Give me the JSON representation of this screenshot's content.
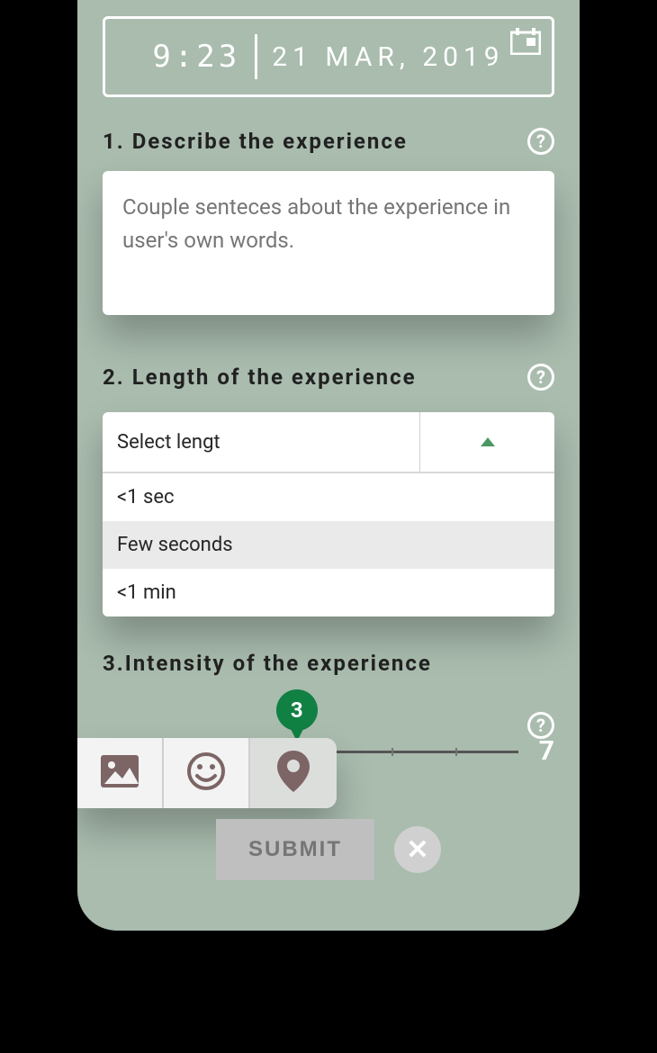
{
  "datetime": {
    "time": "9:23",
    "date": "21 MAR, 2019"
  },
  "sections": {
    "describe": {
      "title": "1. Describe the experience",
      "placeholder": "Couple senteces about the experience in user's own words."
    },
    "length": {
      "title": "2. Length of the experience",
      "select_label": "Select lengt",
      "options": [
        "<1 sec",
        "Few seconds",
        "<1 min"
      ],
      "selected_index": 1
    },
    "intensity": {
      "title": "3.Intensity of the experience",
      "min": "1",
      "max": "7",
      "value": "3",
      "value_fraction": 0.4166
    }
  },
  "submit": {
    "label": "SUBMIT"
  },
  "colors": {
    "accent": "#108043"
  }
}
